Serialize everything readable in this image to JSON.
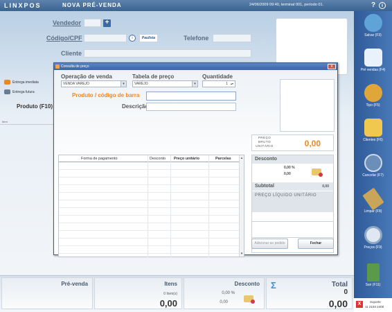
{
  "topbar": {
    "logo": "LINXPOS",
    "app_name": "NOVA PRÉ-VENDA",
    "status": "24/06/2009 09:40, terminal 001, período 01.",
    "help_icon": "help-icon",
    "info_icon": "info-icon"
  },
  "form": {
    "vendedor_label": "Vendedor",
    "codigo_label": "Código/CPF",
    "telefone_label": "Telefone",
    "cliente_label": "Cliente",
    "paulista_label": "Paulista"
  },
  "entrega": {
    "imediata": "Entrega imediata",
    "futura": "Entrega futura"
  },
  "produto_header": "Produto (F10)",
  "item_header": "Item",
  "sidebar": {
    "items": [
      {
        "label": "Salvar (F3)",
        "icon": "save-icon",
        "color": "#5fa3d8"
      },
      {
        "label": "Pré vendas (F4)",
        "icon": "documents-icon",
        "color": "#e9f1fb"
      },
      {
        "label": "Tipo (F5)",
        "icon": "people-icon",
        "color": "#e1a63a"
      },
      {
        "label": "Clientes (F6)",
        "icon": "folder-users-icon",
        "color": "#f0c850"
      },
      {
        "label": "Cancelar (F7)",
        "icon": "cancel-icon",
        "color": "#6b8fb8"
      },
      {
        "label": "Limpar (F8)",
        "icon": "broom-icon",
        "color": "#c9a55a"
      },
      {
        "label": "Preços (F9)",
        "icon": "magnifier-icon",
        "color": "#dfe8f2"
      },
      {
        "label": "Sair (F11)",
        "icon": "exit-door-icon",
        "color": "#5a9a48"
      }
    ],
    "support_label": "Suporte",
    "support_phone": "11 2103 2400"
  },
  "bottom": {
    "prevenda_label": "Pré-venda",
    "itens_label": "Itens",
    "itens_count": "0 Item(s)",
    "itens_value": "0,00",
    "desconto_label": "Desconto",
    "desconto_pct": "0,00 %",
    "desconto_value": "0,00",
    "total_label": "Total",
    "total_count": "0",
    "total_value": "0,00",
    "sigma": "Σ"
  },
  "dialog": {
    "title": "Consulta de preço",
    "close": "x",
    "operacao_label": "Operação de venda",
    "operacao_value": "VENDA VAREJO",
    "tabela_label": "Tabela de preço",
    "tabela_value": "VAREJO",
    "quantidade_label": "Quantidade",
    "quantidade_value": "1",
    "produto_label": "Produto / código de barra",
    "descricao_label": "Descrição",
    "grid_columns": [
      "Forma de pagamento",
      "Desconto",
      "Preço unitário",
      "Parcelas"
    ],
    "preco_bruto_label": "PREÇO BRUTO UNITÁRIO",
    "preco_bruto_value": "0,00",
    "desconto_label": "Desconto",
    "desconto_pct": "0,00 %",
    "desconto_value": "0,00",
    "subtotal_label": "Subtotal",
    "subtotal_value": "0,00",
    "preco_liquido_label": "PREÇO LÍQUIDO UNITÁRIO",
    "adicionar_button": "Adicionar ao pedido",
    "fechar_button": "Fechar"
  }
}
